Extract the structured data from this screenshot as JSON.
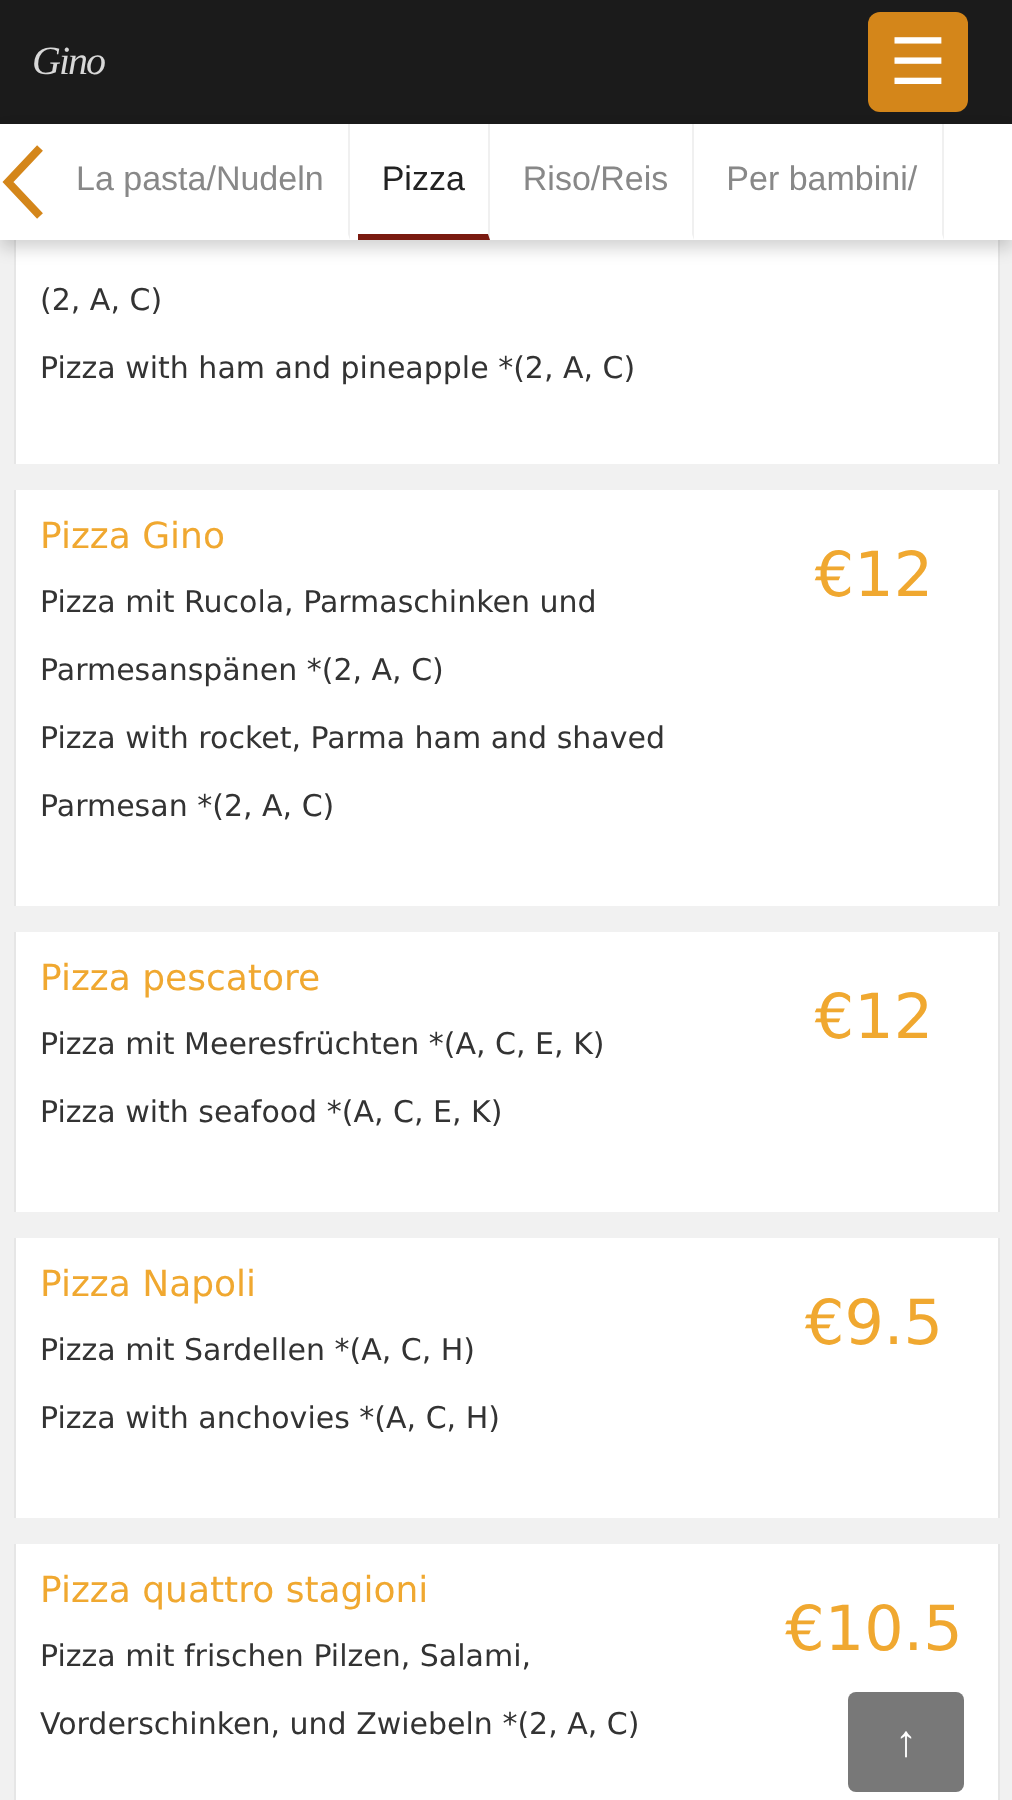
{
  "header": {
    "logo": "Gino",
    "menu_button": "☰"
  },
  "tabs": [
    {
      "label": "La pasta/Nudeln",
      "selected": false
    },
    {
      "label": "Pizza",
      "selected": true
    },
    {
      "label": "Riso/Reis",
      "selected": false
    },
    {
      "label": "Per bambini/",
      "selected": false
    }
  ],
  "menu_items": [
    {
      "lines": [
        "(2, A, C)",
        "Pizza with ham and pineapple *(2, A, C)"
      ]
    },
    {
      "title": "Pizza Gino",
      "price": "€12",
      "lines": [
        "Pizza mit Rucola, Parmaschinken und",
        "Parmesanspänen *(2, A, C)",
        "Pizza with rocket, Parma ham and shaved",
        "Parmesan *(2, A, C)"
      ]
    },
    {
      "title": "Pizza pescatore",
      "price": "€12",
      "lines": [
        "Pizza mit Meeresfrüchten *(A, C, E, K)",
        "Pizza with seafood *(A, C, E, K)"
      ]
    },
    {
      "title": "Pizza Napoli",
      "price": "€9.5",
      "lines": [
        "Pizza mit Sardellen *(A, C, H)",
        "Pizza with anchovies *(A, C, H)"
      ]
    },
    {
      "title": "Pizza quattro stagioni",
      "price": "€10.5",
      "lines": [
        "Pizza mit frischen Pilzen, Salami,",
        "Vorderschinken, und Zwiebeln *(2, A, C)"
      ]
    }
  ],
  "scroll_top_button": "↑"
}
